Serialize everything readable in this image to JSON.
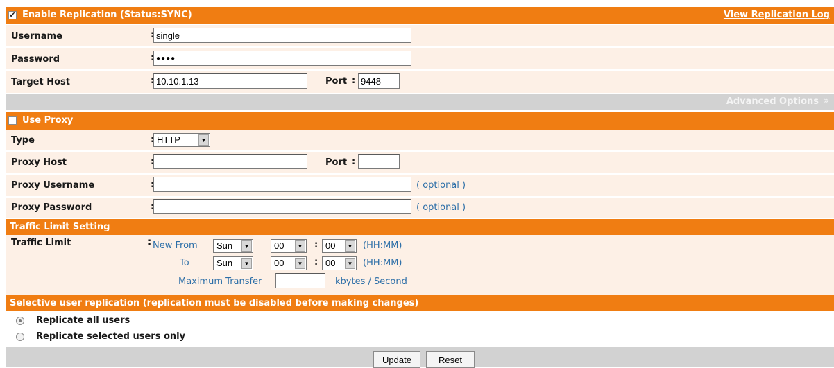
{
  "replication": {
    "enable_label": "Enable Replication (Status:SYNC)",
    "enabled": true,
    "view_log_label": "View Replication Log",
    "username_label": "Username",
    "username_value": "single",
    "password_label": "Password",
    "password_value": "●●●●",
    "target_host_label": "Target Host",
    "target_host_value": "10.10.1.13",
    "port_label": "Port",
    "port_value": "9448",
    "colon": ":"
  },
  "advanced": {
    "label": "Advanced Options",
    "icon": "double-chevron-up-icon"
  },
  "proxy": {
    "use_label": "Use Proxy",
    "enabled": false,
    "type_label": "Type",
    "type_value": "HTTP",
    "host_label": "Proxy Host",
    "host_value": "",
    "port_label": "Port",
    "port_value": "",
    "username_label": "Proxy Username",
    "username_value": "",
    "password_label": "Proxy Password",
    "password_value": "",
    "optional_note": "( optional )"
  },
  "traffic": {
    "section_title": "Traffic Limit Setting",
    "limit_label": "Traffic Limit",
    "new_from_label": "New From",
    "to_label": "To",
    "from_day": "Sun",
    "from_hour": "00",
    "from_minute": "00",
    "to_day": "Sun",
    "to_hour": "00",
    "to_minute": "00",
    "time_format": "(HH:MM)",
    "max_transfer_label": "Maximum Transfer",
    "max_transfer_value": "",
    "unit_label": "kbytes / Second"
  },
  "selective": {
    "section_title": "Selective user replication (replication must be disabled before making changes)",
    "all_users_label": "Replicate all users",
    "selected_users_label": "Replicate selected users only",
    "selected_option": "all"
  },
  "actions": {
    "update_label": "Update",
    "reset_label": "Reset"
  },
  "colors": {
    "accent": "#f07d12",
    "row_bg": "#fdf0e6",
    "gray_bar": "#d2d2d2",
    "link_blue": "#2d6fa8"
  }
}
